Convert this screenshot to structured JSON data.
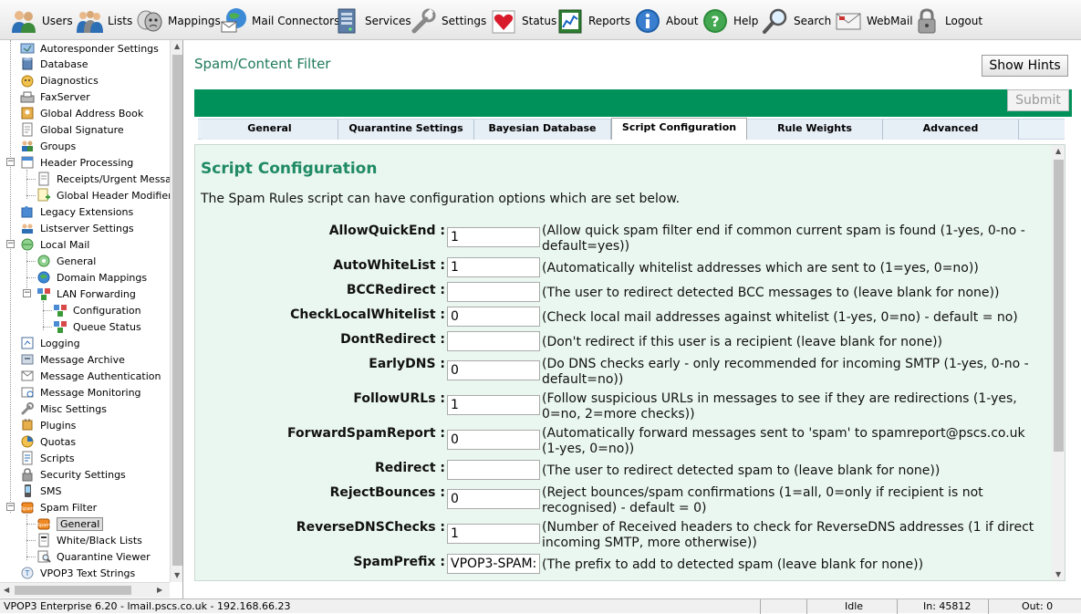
{
  "toolbar": {
    "items": [
      {
        "label": "Users",
        "icon": "users-icon"
      },
      {
        "label": "Lists",
        "icon": "lists-icon"
      },
      {
        "label": "Mappings",
        "icon": "masks-icon"
      },
      {
        "label": "Mail Connectors",
        "icon": "mail-globe-icon"
      },
      {
        "label": "Services",
        "icon": "server-icon"
      },
      {
        "label": "Settings",
        "icon": "wrench-icon"
      },
      {
        "label": "Status",
        "icon": "heart-icon"
      },
      {
        "label": "Reports",
        "icon": "chart-icon"
      },
      {
        "label": "About",
        "icon": "info-icon"
      },
      {
        "label": "Help",
        "icon": "help-icon"
      },
      {
        "label": "Search",
        "icon": "magnifier-icon"
      },
      {
        "label": "WebMail",
        "icon": "webmail-icon"
      },
      {
        "label": "Logout",
        "icon": "padlock-icon"
      }
    ]
  },
  "tree": {
    "items": [
      {
        "label": "Autoresponder Settings"
      },
      {
        "label": "Database"
      },
      {
        "label": "Diagnostics"
      },
      {
        "label": "FaxServer"
      },
      {
        "label": "Global Address Book"
      },
      {
        "label": "Global Signature"
      },
      {
        "label": "Groups"
      },
      {
        "label": "Header Processing"
      },
      {
        "label": "Receipts/Urgent Messages"
      },
      {
        "label": "Global Header Modifiers"
      },
      {
        "label": "Legacy Extensions"
      },
      {
        "label": "Listserver Settings"
      },
      {
        "label": "Local Mail"
      },
      {
        "label": "General"
      },
      {
        "label": "Domain Mappings"
      },
      {
        "label": "LAN Forwarding"
      },
      {
        "label": "Configuration"
      },
      {
        "label": "Queue Status"
      },
      {
        "label": "Logging"
      },
      {
        "label": "Message Archive"
      },
      {
        "label": "Message Authentication"
      },
      {
        "label": "Message Monitoring"
      },
      {
        "label": "Misc Settings"
      },
      {
        "label": "Plugins"
      },
      {
        "label": "Quotas"
      },
      {
        "label": "Scripts"
      },
      {
        "label": "Security Settings"
      },
      {
        "label": "SMS"
      },
      {
        "label": "Spam Filter"
      },
      {
        "label": "General"
      },
      {
        "label": "White/Black Lists"
      },
      {
        "label": "Quarantine Viewer"
      },
      {
        "label": "VPOP3 Text Strings"
      }
    ]
  },
  "main": {
    "page_title": "Spam/Content Filter",
    "show_hints_label": "Show Hints",
    "submit_label": "Submit",
    "tabs": [
      "General",
      "Quarantine Settings",
      "Bayesian Database",
      "Script Configuration",
      "Rule Weights",
      "Advanced"
    ],
    "active_tab": "Script Configuration",
    "section_title": "Script Configuration",
    "intro": "The Spam Rules script can have configuration options which are set below.",
    "options": [
      {
        "name": "AllowQuickEnd :",
        "value": "1",
        "desc": "(Allow quick spam filter end if common current spam is found (1-yes, 0-no - default=yes))"
      },
      {
        "name": "AutoWhiteList :",
        "value": "1",
        "desc": "(Automatically whitelist addresses which are sent to (1=yes, 0=no))"
      },
      {
        "name": "BCCRedirect :",
        "value": "",
        "desc": "(The user to redirect detected BCC messages to (leave blank for none))"
      },
      {
        "name": "CheckLocalWhitelist :",
        "value": "0",
        "desc": "(Check local mail addresses against whitelist (1-yes, 0=no) - default = no)"
      },
      {
        "name": "DontRedirect :",
        "value": "",
        "desc": "(Don't redirect if this user is a recipient (leave blank for none))"
      },
      {
        "name": "EarlyDNS :",
        "value": "0",
        "desc": "(Do DNS checks early - only recommended for incoming SMTP (1-yes, 0-no - default=no))"
      },
      {
        "name": "FollowURLs :",
        "value": "1",
        "desc": "(Follow suspicious URLs in messages to see if they are redirections (1-yes, 0=no, 2=more checks))"
      },
      {
        "name": "ForwardSpamReport :",
        "value": "0",
        "desc": "(Automatically forward messages sent to 'spam' to spamreport@pscs.co.uk (1-yes, 0=no))"
      },
      {
        "name": "Redirect :",
        "value": "",
        "desc": "(The user to redirect detected spam to (leave blank for none))"
      },
      {
        "name": "RejectBounces :",
        "value": "0",
        "desc": "(Reject bounces/spam confirmations (1=all, 0=only if recipient is not recognised) - default = 0)"
      },
      {
        "name": "ReverseDNSChecks :",
        "value": "1",
        "desc": "(Number of Received headers to check for ReverseDNS addresses (1 if direct incoming SMTP, more otherwise))"
      },
      {
        "name": "SpamPrefix :",
        "value": "VPOP3-SPAM:",
        "desc": "(The prefix to add to detected spam (leave blank for none))"
      }
    ]
  },
  "statusbar": {
    "app": "VPOP3 Enterprise 6.20 - lmail.pscs.co.uk - 192.168.66.23",
    "state": "Idle",
    "in": "In: 45812",
    "out": "Out: 0"
  }
}
